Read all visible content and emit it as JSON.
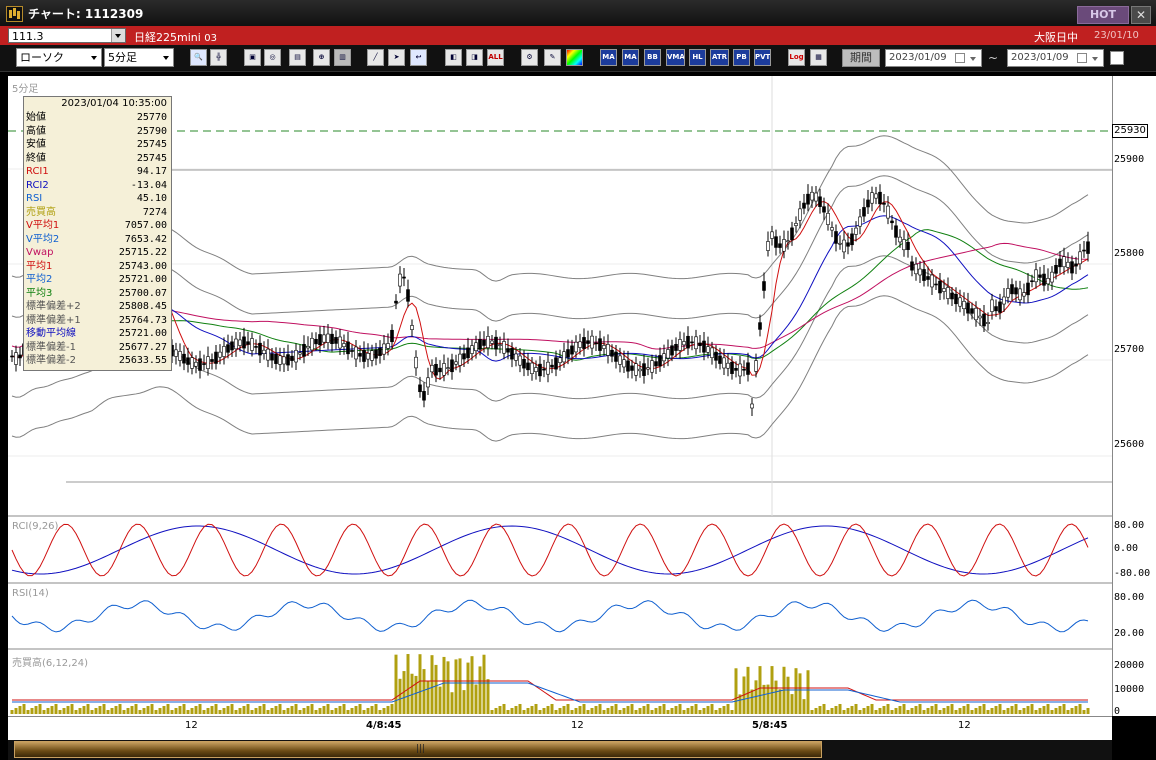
{
  "window": {
    "title": "チャート: 1112309",
    "hot_label": "HOT",
    "close_label": "✕"
  },
  "infobar": {
    "symbol": "111.3",
    "instrument": "日経225mini",
    "contract": "03",
    "session": "大阪日中",
    "date": "23/01/10"
  },
  "toolbar": {
    "chart_type": "ローソク",
    "interval": "5分足",
    "buttons": [
      "zoom",
      "cursor",
      "marker",
      "search-zoom",
      "scale",
      "split",
      "gray",
      "draw",
      "pointer",
      "undo",
      "candle-a",
      "candle-b",
      "ALL",
      "gear",
      "brush",
      "palette",
      "MA",
      "MA",
      "BB",
      "VMA",
      "HL",
      "ATR",
      "PB",
      "PVT",
      "Log",
      "panel"
    ],
    "period_label": "期間",
    "date_from": "2023/01/09",
    "date_to": "2023/01/09",
    "tilde": "~"
  },
  "chart": {
    "main_label": "5分足",
    "rci_label": "RCI(9,26)",
    "rsi_label": "RSI(14)",
    "vol_label": "売買高(6,12,24)",
    "price_tag": "25930",
    "y_main": [
      "25900",
      "25800",
      "25700",
      "25600"
    ],
    "y_rci": [
      "80.00",
      "0.00",
      "-80.00"
    ],
    "y_rsi": [
      "80.00",
      "20.00"
    ],
    "y_vol": [
      "20000",
      "10000",
      "0"
    ],
    "x_labels": [
      "12",
      "4/8:45",
      "12",
      "5/8:45",
      "12"
    ]
  },
  "datawindow": {
    "timestamp": "2023/01/04 10:35:00",
    "rows": [
      {
        "label": "始値",
        "value": "25770",
        "color": "#000000"
      },
      {
        "label": "高値",
        "value": "25790",
        "color": "#000000"
      },
      {
        "label": "安値",
        "value": "25745",
        "color": "#000000"
      },
      {
        "label": "終値",
        "value": "25745",
        "color": "#000000"
      },
      {
        "label": "RCI1",
        "value": "94.17",
        "color": "#d01010"
      },
      {
        "label": "RCI2",
        "value": "-13.04",
        "color": "#1010c0"
      },
      {
        "label": "RSI",
        "value": "45.10",
        "color": "#1060d0"
      },
      {
        "label": "売買高",
        "value": "7274",
        "color": "#b0a010"
      },
      {
        "label": "V平均1",
        "value": "7057.00",
        "color": "#d01010"
      },
      {
        "label": "V平均2",
        "value": "7653.42",
        "color": "#1060d0"
      },
      {
        "label": "Vwap",
        "value": "25715.22",
        "color": "#c01060"
      },
      {
        "label": "平均1",
        "value": "25743.00",
        "color": "#d01010"
      },
      {
        "label": "平均2",
        "value": "25721.00",
        "color": "#1060d0"
      },
      {
        "label": "平均3",
        "value": "25700.07",
        "color": "#108010"
      },
      {
        "label": "標準偏差+2",
        "value": "25808.45",
        "color": "#555555"
      },
      {
        "label": "標準偏差+1",
        "value": "25764.73",
        "color": "#555555"
      },
      {
        "label": "移動平均線",
        "value": "25721.00",
        "color": "#1010c0"
      },
      {
        "label": "標準偏差-1",
        "value": "25677.27",
        "color": "#555555"
      },
      {
        "label": "標準偏差-2",
        "value": "25633.55",
        "color": "#555555"
      }
    ]
  },
  "colors": {
    "titlebar": "#1a1a1a",
    "infobar": "#c02020",
    "candle_up": "#ffffff",
    "candle_down": "#000000",
    "ma1": "#d01010",
    "ma2": "#1010c0",
    "ma3": "#108010",
    "vwap": "#c01060",
    "bands": "#808080",
    "volume": "#b0a010"
  }
}
